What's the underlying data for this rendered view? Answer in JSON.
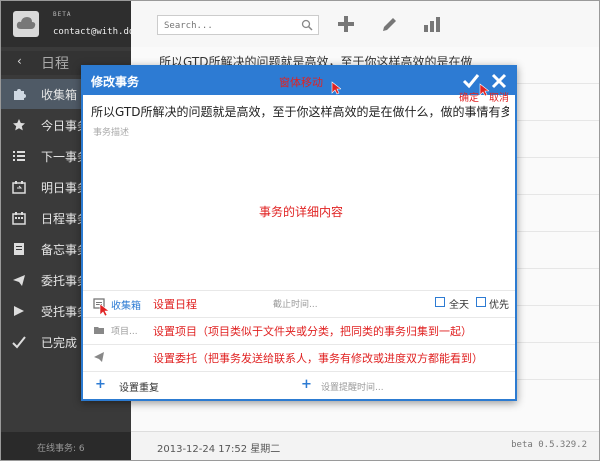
{
  "sidebar": {
    "beta": "BETA",
    "email": "contact@with.do",
    "calendar_title": "日程",
    "items": [
      {
        "label": "收集箱",
        "icon": "puzzle-icon"
      },
      {
        "label": "今日事务",
        "icon": "star-icon"
      },
      {
        "label": "下一事务",
        "icon": "list-icon"
      },
      {
        "label": "明日事务",
        "icon": "calendar-arrow-icon"
      },
      {
        "label": "日程事务",
        "icon": "calendar-icon"
      },
      {
        "label": "备忘事务",
        "icon": "memo-icon"
      },
      {
        "label": "委托事务",
        "icon": "send-icon"
      },
      {
        "label": "受托事务",
        "icon": "flag-icon"
      },
      {
        "label": "已完成",
        "icon": "check-icon"
      }
    ],
    "online_count": "在线事务: 6"
  },
  "topbar": {
    "search_placeholder": "Search..."
  },
  "list": {
    "first_row": "所以GTD所解决的问题就是高效，至于你这样高效的是在做"
  },
  "statusbar": {
    "datetime": "2013-12-24 17:52 星期二",
    "version": "beta 0.5.329.2"
  },
  "dialog": {
    "title": "修改事务",
    "task_title": "所以GTD所解决的问题就是高效，至于你这样高效的是在做什么，做的事情有多",
    "description_placeholder": "事务描述",
    "inbox_label": "收集箱",
    "deadline_label": "截止时间...",
    "allday_label": "全天",
    "priority_label": "优先",
    "project_label": "项目...",
    "repeat_label": "设置重复",
    "reminder_label": "设置提醒时间..."
  },
  "annotations": {
    "move_window": "窗体移动",
    "confirm": "确定",
    "cancel": "取消",
    "detail_content": "事务的详细内容",
    "set_schedule": "设置日程",
    "set_project": "设置项目（项目类似于文件夹或分类，把同类的事务归集到一起）",
    "set_delegate": "设置委托（把事务发送给联系人，事务有修改或进度双方都能看到）"
  },
  "colors": {
    "accent": "#2d7bd3",
    "annotation": "#e02222",
    "sidebar": "#3a3a3a"
  }
}
